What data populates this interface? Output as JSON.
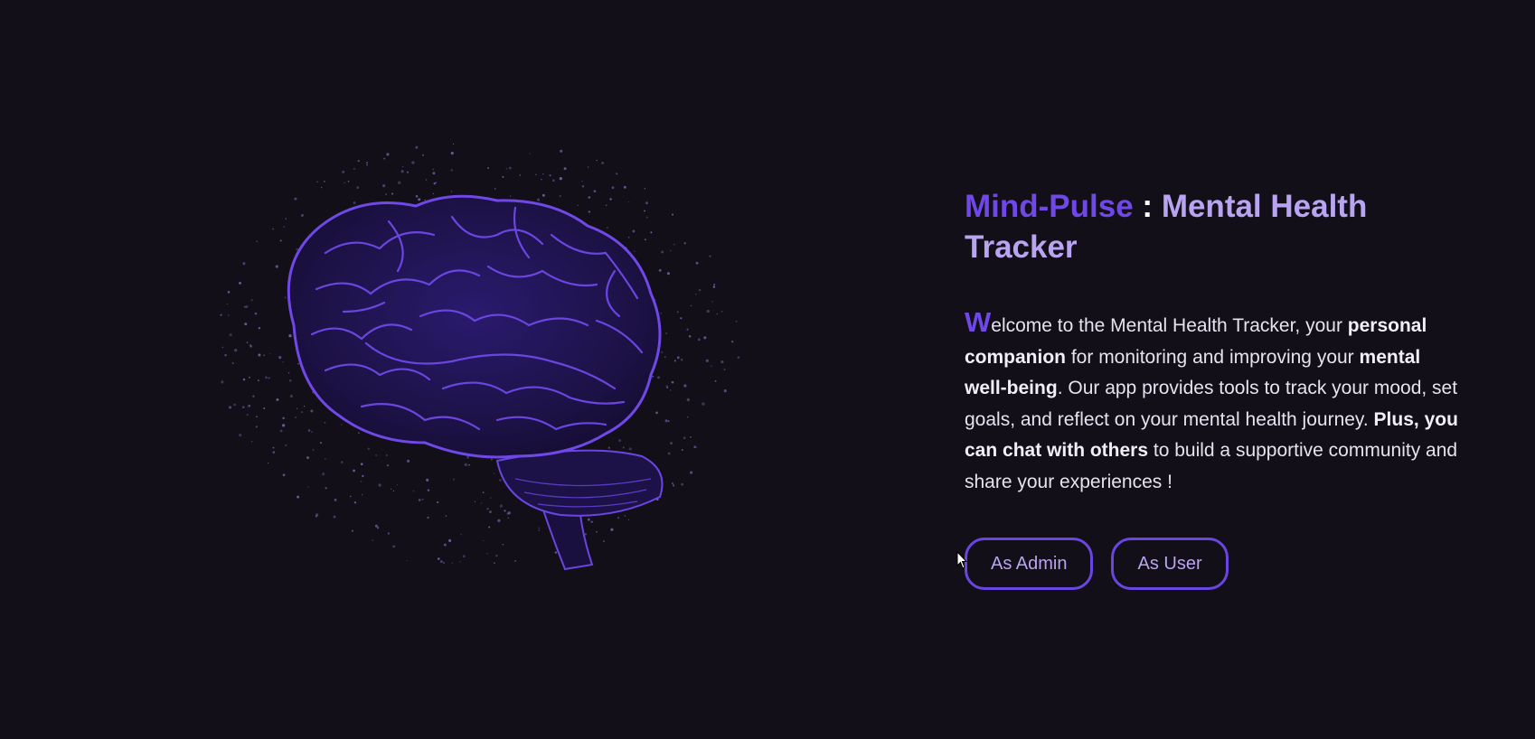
{
  "hero": {
    "image": "brain-particles-icon",
    "accent_color": "#6b45e0"
  },
  "title": {
    "brand": "Mind-Pulse",
    "separator": ":",
    "rest": "Mental Health Tracker"
  },
  "description": {
    "dropcap": "W",
    "t1": "elcome to the Mental Health Tracker, your ",
    "b1": "personal companion",
    "t2": " for monitoring and improving your ",
    "b2": "mental well-being",
    "t3": ". Our app provides tools to track your mood, set goals, and reflect on your mental health journey. ",
    "b3": "Plus, you can chat with others",
    "t4": " to build a supportive community and share your experiences !"
  },
  "buttons": {
    "admin_label": "As Admin",
    "user_label": "As User"
  },
  "colors": {
    "background": "#120f19",
    "brand": "#7048e8",
    "accent_text": "#b9a4f2",
    "body_text": "#e6e2f0"
  }
}
